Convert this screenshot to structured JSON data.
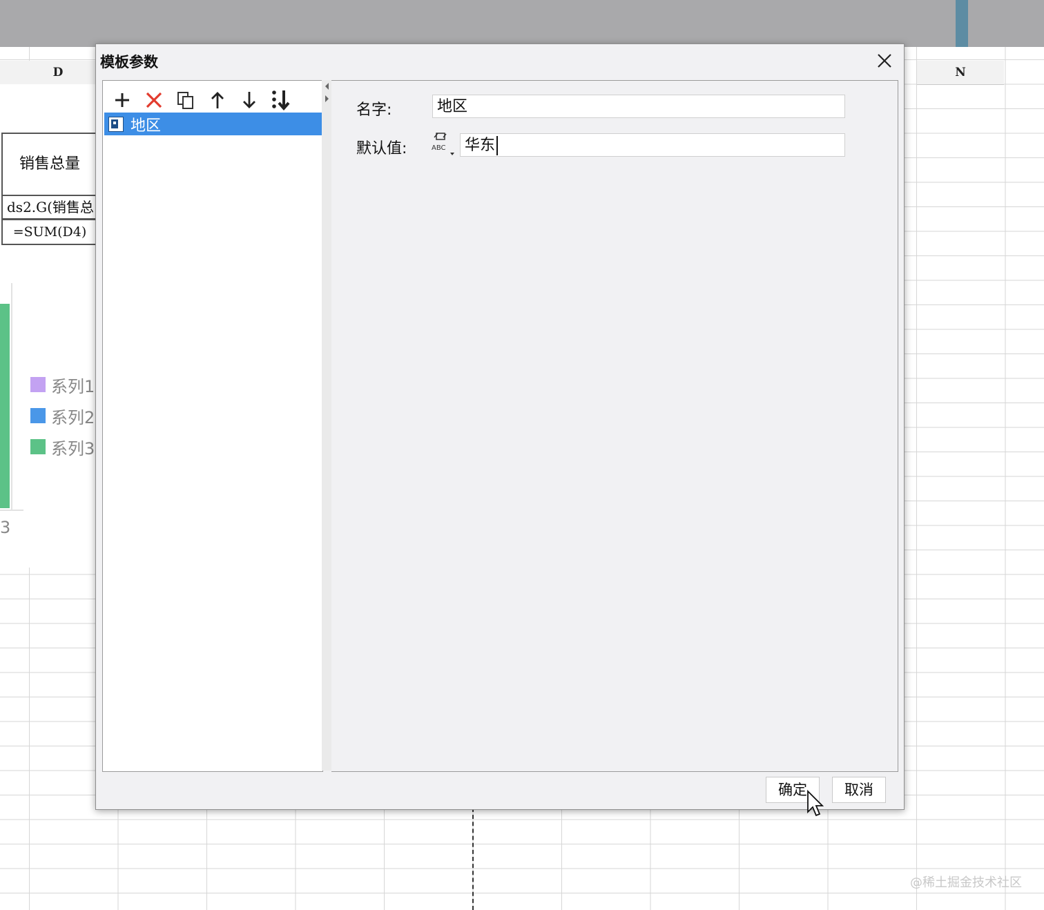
{
  "spreadsheet": {
    "col_headers": [
      "D",
      "N"
    ],
    "header_cell": "销售总量",
    "data_cell": "ds2.G(销售总",
    "formula_cell": "=SUM(D4)",
    "legend": [
      {
        "label": "系列1",
        "color": "#c3a2f2"
      },
      {
        "label": "系列2",
        "color": "#4a97e8"
      },
      {
        "label": "系列3",
        "color": "#5cc287"
      }
    ],
    "axis_label": "3"
  },
  "dialog": {
    "title": "模板参数",
    "toolbar": [
      "add-icon",
      "delete-icon",
      "copy-icon",
      "move-up-icon",
      "move-down-icon",
      "sort-icon"
    ],
    "parameters": [
      {
        "name": "地区",
        "selected": true
      }
    ],
    "fields": {
      "name_label": "名字:",
      "name_value": "地区",
      "default_label": "默认值:",
      "default_value": "华东",
      "type_icon_text": "ABC"
    },
    "buttons": {
      "ok": "确定",
      "cancel": "取消"
    }
  },
  "watermark": "@稀土掘金技术社区",
  "colors": {
    "selection": "#3d8ee6",
    "dialog_bg": "#f1f1f3",
    "delete_red": "#e23b2e"
  }
}
